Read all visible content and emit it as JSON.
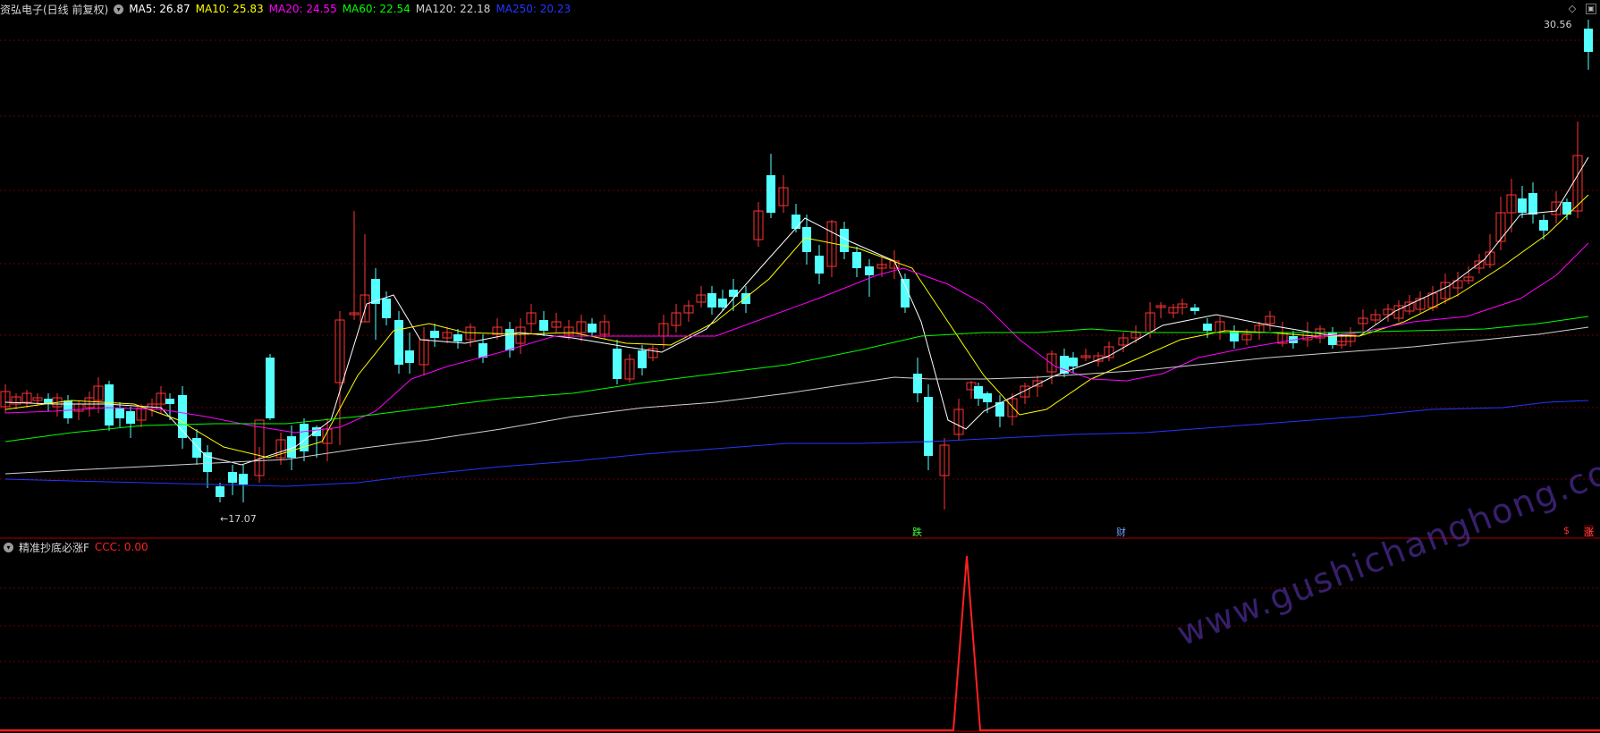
{
  "header": {
    "title": "资弘电子(日线 前复权)",
    "mas": [
      {
        "label": "MA5: 26.87",
        "color": "#ffffff"
      },
      {
        "label": "MA10: 25.83",
        "color": "#ffff00"
      },
      {
        "label": "MA20: 24.55",
        "color": "#ff00ff"
      },
      {
        "label": "MA60: 22.54",
        "color": "#00ff00"
      },
      {
        "label": "MA120: 22.18",
        "color": "#cfcfcf"
      },
      {
        "label": "MA250: 20.23",
        "color": "#2436ff"
      }
    ]
  },
  "price_labels": {
    "high": "30.56",
    "low": "17.07"
  },
  "event_markers": {
    "die": "跌",
    "cai": "财",
    "dollar": "$",
    "zhang": "涨"
  },
  "indicator": {
    "name": "精准抄底必涨F",
    "value_label": "CCC: 0.00",
    "value_color": "#ff2020"
  },
  "watermark": "www.gushichanghong.com",
  "colors": {
    "up": "#ff3333",
    "down": "#54ffff",
    "grid": "#6a0000",
    "border": "#a00000"
  }
}
